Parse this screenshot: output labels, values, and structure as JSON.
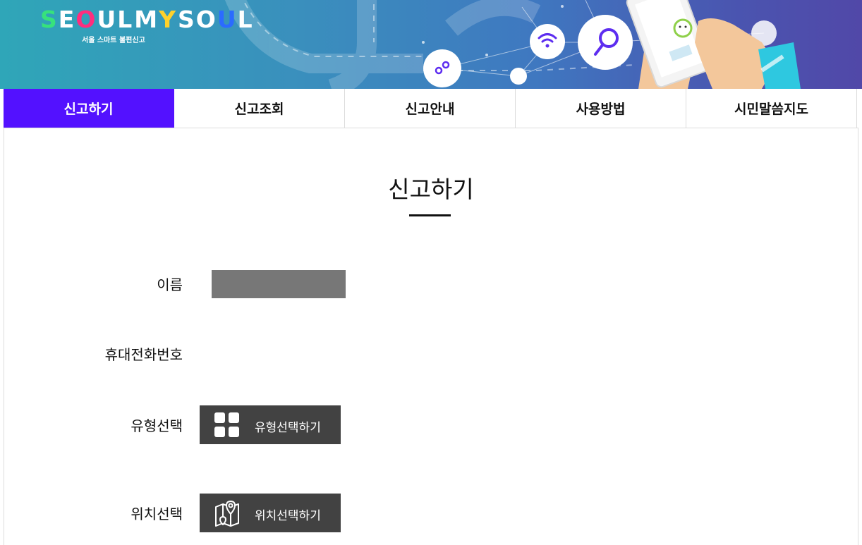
{
  "header": {
    "logo_letters": [
      "S",
      "E",
      "O",
      "U",
      "L",
      " ",
      "M",
      "Y",
      " ",
      "S",
      "O",
      "U",
      "L"
    ],
    "logo_subtitle": "서울 스마트 불편신고",
    "colors": {
      "logo_letters": [
        "#37e27c",
        "#ffffff",
        "#ff2d7e",
        "#ffffff",
        "#ffffff",
        "#ffffff",
        "#ffffff",
        "#ffd12b",
        "#ffffff",
        "#ffffff",
        "#ffffff",
        "#2b6bff",
        "#ffffff"
      ]
    },
    "icons": [
      "gear-icon",
      "wifi-icon",
      "magnifier-icon",
      "smartphone-icon"
    ]
  },
  "tabs": [
    {
      "label": "신고하기",
      "active": true
    },
    {
      "label": "신고조회",
      "active": false
    },
    {
      "label": "신고안내",
      "active": false
    },
    {
      "label": "사용방법",
      "active": false
    },
    {
      "label": "시민말씀지도",
      "active": false
    }
  ],
  "main": {
    "title": "신고하기",
    "form": {
      "name_label": "이름",
      "phone_label": "휴대전화번호",
      "type_label": "유형선택",
      "type_button": "유형선택하기",
      "location_label": "위치선택",
      "location_button": "위치선택하기"
    }
  },
  "colors": {
    "accent": "#5311ff",
    "button": "#424242",
    "redacted_field": "#777777"
  }
}
